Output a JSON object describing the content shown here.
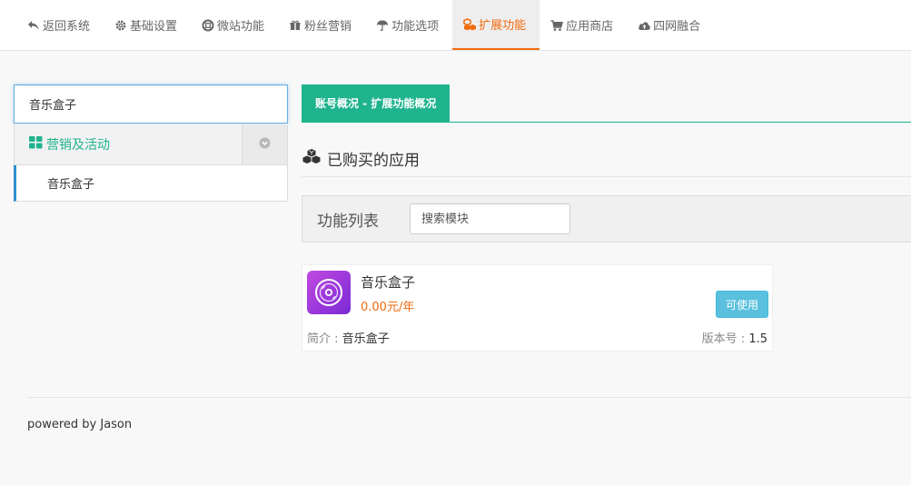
{
  "nav": {
    "items": [
      {
        "label": "返回系统",
        "icon": "reply-icon"
      },
      {
        "label": "基础设置",
        "icon": "gear-icon"
      },
      {
        "label": "微站功能",
        "icon": "lifebuoy-icon"
      },
      {
        "label": "粉丝营销",
        "icon": "gift-icon"
      },
      {
        "label": "功能选项",
        "icon": "umbrella-icon"
      },
      {
        "label": "扩展功能",
        "icon": "cubes-icon"
      },
      {
        "label": "应用商店",
        "icon": "cart-icon"
      },
      {
        "label": "四网融合",
        "icon": "cloud-upload-icon"
      }
    ],
    "active_index": 5,
    "active_color": "#f26b0f"
  },
  "sidebar": {
    "search_value": "音乐盒子",
    "category": {
      "label": "营销及活动",
      "color": "#1fb38e"
    },
    "sub_items": [
      {
        "label": "音乐盒子"
      }
    ]
  },
  "main": {
    "tab_label": "账号概况 - 扩展功能概况",
    "section_title": "已购买的应用",
    "filter": {
      "label": "功能列表",
      "placeholder": "搜索模块"
    },
    "apps": [
      {
        "name": "音乐盒子",
        "price": "0.00元/年",
        "button_label": "可使用",
        "desc_label": "简介 : ",
        "desc_value": "音乐盒子",
        "version_label": "版本号 : ",
        "version_value": "1.5"
      }
    ]
  },
  "footer": {
    "text": "powered by Jason"
  }
}
